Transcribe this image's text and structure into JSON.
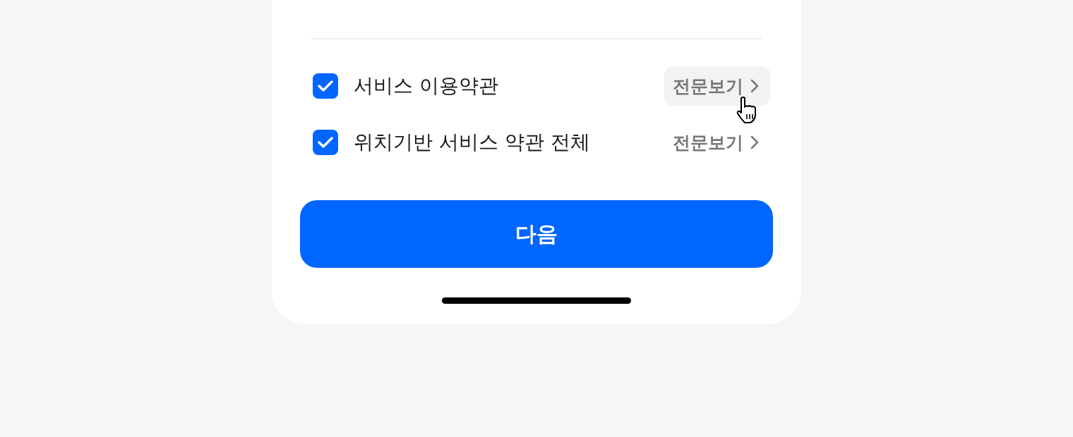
{
  "terms": [
    {
      "label": "서비스 이용약관",
      "checked": true,
      "link": "전문보기",
      "hovered": true
    },
    {
      "label": "위치기반 서비스 약관 전체",
      "checked": true,
      "link": "전문보기",
      "hovered": false
    }
  ],
  "next_button": "다음"
}
